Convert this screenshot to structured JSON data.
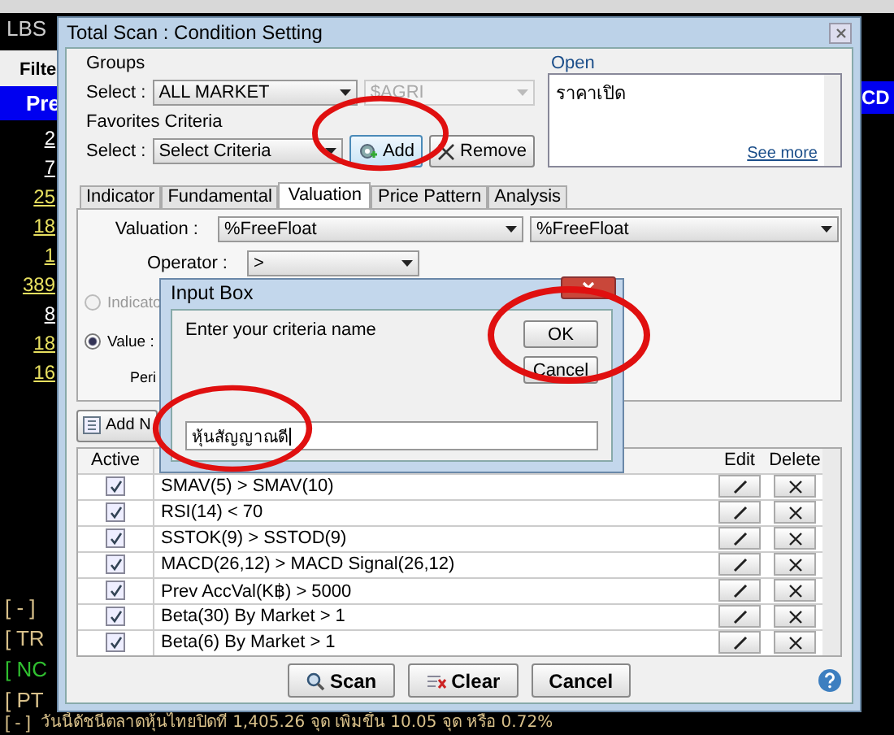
{
  "background": {
    "top_label": "LBS",
    "filter_label": "Filte",
    "header_left": "Pre",
    "header_right": "CD",
    "values": [
      {
        "text": "2",
        "color": "#ffffff"
      },
      {
        "text": "7",
        "color": "#ffffff"
      },
      {
        "text": "25",
        "color": "#e8e060"
      },
      {
        "text": "18",
        "color": "#e8e060"
      },
      {
        "text": "1",
        "color": "#e8e060"
      },
      {
        "text": "389",
        "color": "#e8e060"
      },
      {
        "text": "8",
        "color": "#ffffff"
      },
      {
        "text": "18",
        "color": "#e8e060"
      },
      {
        "text": "16",
        "color": "#e8e060"
      }
    ],
    "news": [
      {
        "text": "[ - ]",
        "color": "#d8c08a"
      },
      {
        "text": "[ TR",
        "color": "#d8c08a"
      },
      {
        "text": "[ NC",
        "color": "#30c030"
      },
      {
        "text": "[ PT",
        "color": "#d8c08a"
      }
    ],
    "ticker_tag": "[ - ]",
    "ticker": "วันนี้ดัชนีตลาดหุ้นไทยปิดที่ 1,405.26 จุด เพิ่มขึ้น 10.05 จุด หรือ 0.72%"
  },
  "dialog": {
    "title": "Total Scan : Condition Setting",
    "groups": {
      "label": "Groups",
      "select_label": "Select :",
      "market": "ALL MARKET",
      "sector": "$AGRI",
      "sector_disabled": true
    },
    "favorites": {
      "label": "Favorites Criteria",
      "select_label": "Select :",
      "value": "Select Criteria",
      "add": "Add",
      "remove": "Remove"
    },
    "open": {
      "label": "Open",
      "text": "ราคาเปิด",
      "link": "See more"
    },
    "tabs": [
      {
        "label": "Indicator",
        "selected": false
      },
      {
        "label": "Fundamental",
        "selected": false
      },
      {
        "label": "Valuation",
        "selected": true
      },
      {
        "label": "Price Pattern",
        "selected": false
      },
      {
        "label": "Analysis",
        "selected": false
      }
    ],
    "valuation": {
      "label": "Valuation :",
      "left": "%FreeFloat",
      "right": "%FreeFloat",
      "operator_label": "Operator :",
      "operator": ">",
      "options": [
        {
          "label": "Indicato",
          "selected": false,
          "disabled": true
        },
        {
          "label": "Value :",
          "selected": true,
          "disabled": false
        }
      ],
      "period_label": "Peri"
    },
    "add_new": "Add N",
    "columns": [
      "Active",
      "Edit",
      "Delete"
    ],
    "rows": [
      {
        "active": true,
        "text": "SMAV(5) > SMAV(10)"
      },
      {
        "active": true,
        "text": "RSI(14) < 70"
      },
      {
        "active": true,
        "text": "SSTOK(9) > SSTOD(9)"
      },
      {
        "active": true,
        "text": "MACD(26,12) > MACD Signal(26,12)"
      },
      {
        "active": true,
        "text": "Prev AccVal(K฿) > 5000"
      },
      {
        "active": true,
        "text": "Beta(30) By Market > 1"
      },
      {
        "active": true,
        "text": "Beta(6) By Market > 1"
      }
    ],
    "buttons": [
      "Scan",
      "Clear",
      "Cancel"
    ]
  },
  "input_box": {
    "title": "Input Box",
    "prompt": "Enter your criteria name",
    "value": "หุ้นสัญญาณดี",
    "ok": "OK",
    "cancel": "Cancel"
  }
}
